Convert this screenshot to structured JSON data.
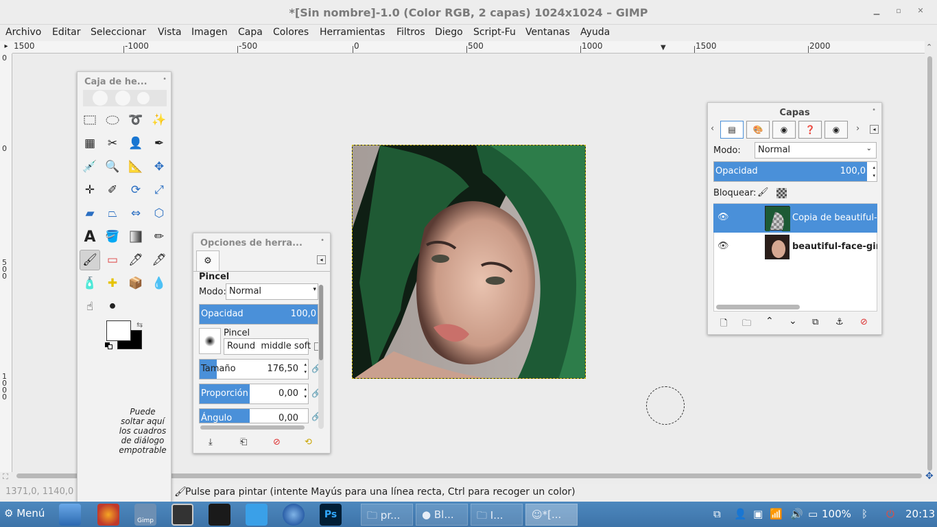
{
  "window": {
    "title": "*[Sin nombre]-1.0 (Color RGB, 2 capas) 1024x1024 – GIMP"
  },
  "menu": [
    "Archivo",
    "Editar",
    "Seleccionar",
    "Vista",
    "Imagen",
    "Capa",
    "Colores",
    "Herramientas",
    "Filtros",
    "Diego",
    "Script-Fu",
    "Ventanas",
    "Ayuda"
  ],
  "ruler": {
    "h_labels": [
      "1500",
      "-1000",
      "-500",
      "0",
      "500",
      "1000",
      "1500",
      "2000"
    ],
    "v_labels": [
      "0",
      "0",
      "500",
      "1000"
    ]
  },
  "toolbox": {
    "title": "Caja de he...",
    "drop_hint": "Puede soltar aquí los cuadros de diálogo empotrable"
  },
  "tool_options": {
    "title": "Opciones de herra...",
    "tool_name": "Pincel",
    "mode_label": "Modo:",
    "mode_value": "Normal",
    "opacity_label": "Opacidad",
    "opacity_value": "100,0",
    "brush_label": "Pincel",
    "brush_name": "Round  middle soft",
    "size_label": "Tamaño",
    "size_value": "176,50",
    "aspect_label": "Proporción de...",
    "aspect_value": "0,00",
    "angle_label": "Ángulo",
    "angle_value": "0,00"
  },
  "layers": {
    "title": "Capas",
    "mode_label": "Modo:",
    "mode_value": "Normal",
    "opacity_label": "Opacidad",
    "opacity_value": "100,0",
    "lock_label": "Bloquear:",
    "items": [
      {
        "name": "Copia de beautiful-fa"
      },
      {
        "name": "beautiful-face-girl"
      }
    ]
  },
  "status": {
    "coords": "1371,0, 1140,0",
    "message": "Pulse para pintar (intente Mayús para una línea recta, Ctrl para recoger un color)"
  },
  "taskbar": {
    "start": "Menú",
    "tasks": [
      "pr...",
      "Bl...",
      "I...",
      "*[..."
    ],
    "battery": "100%",
    "clock": "20:13"
  },
  "colors": {
    "accent": "#4a90d9",
    "taskbar": "#4577ad",
    "selection_border": "#c8b400"
  }
}
